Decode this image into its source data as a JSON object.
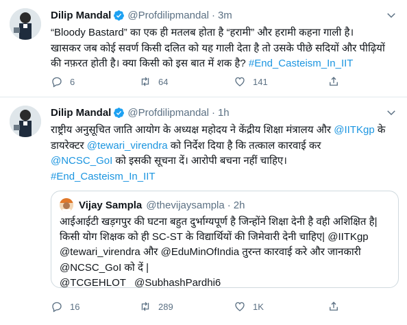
{
  "tweets": [
    {
      "name": "Dilip Mandal",
      "handle": "@Profdilipmandal",
      "separator": "·",
      "time": "3m",
      "lines": [
        "“Bloody Bastard” का एक ही मतलब होता है “हरामी” और हरामी कहना गाली है।",
        "खासकर जब कोई सवर्ण किसी दलित को यह गाली देता है तो उसके पीछे सदियों और पीढ़ियों",
        "की नफ़रत होती है। क्या किसी को इस बात में शक है?"
      ],
      "hashtag": "#End_Casteism_In_IIT",
      "stats": {
        "replies": "6",
        "retweets": "64",
        "likes": "141"
      }
    },
    {
      "name": "Dilip Mandal",
      "handle": "@Profdilipmandal",
      "separator": "·",
      "time": "1h",
      "line1": "राष्ट्रीय अनुसूचित जाति आयोग के अध्यक्ष महोदय ने केंद्रीय शिक्षा मंत्रालय और",
      "mention_iitkgp": "@IITKgp",
      "line1_end": "के",
      "line2_start": "डायरेक्टर",
      "mention_tewari": "@tewari_virendra",
      "line2_end": "को निर्देश दिया है कि तत्काल कारवाई कर",
      "mention_ncsc": "@NCSC_GoI",
      "line3_end": "को इसकी सूचना दें। आरोपी बचना नहीं चाहिए।",
      "hashtag": "#End_Casteism_In_IIT",
      "quote": {
        "name": "Vijay Sampla",
        "handle": "@thevijaysampla",
        "separator": "·",
        "time": "2h",
        "line1": "आईआईटी खड़गपुर की घटना बहुत दुर्भाग्यपूर्ण है जिन्होंने शिक्षा देनी है वही अशिक्षित है|",
        "line2": "किसी योग शिक्षक को ही SC-ST के विद्यार्थियों की जिमेवारी देनी चाहिए| @IITKgp",
        "line3": "@tewari_virendra और @EduMinOfIndia तुरन्त कारवाई करे और जानकारी",
        "line4": "@NCSC_GoI को दें |",
        "line5": "@TCGEHLOT   @SubhashPardhi6"
      },
      "stats": {
        "replies": "16",
        "retweets": "289",
        "likes": "1K"
      }
    }
  ],
  "colors": {
    "link": "#1b95e0",
    "muted": "#5b7083",
    "verified": "#1da1f2"
  },
  "icons": [
    "verified-badge-icon",
    "chevron-down-icon",
    "reply-icon",
    "retweet-icon",
    "like-icon",
    "share-icon"
  ]
}
